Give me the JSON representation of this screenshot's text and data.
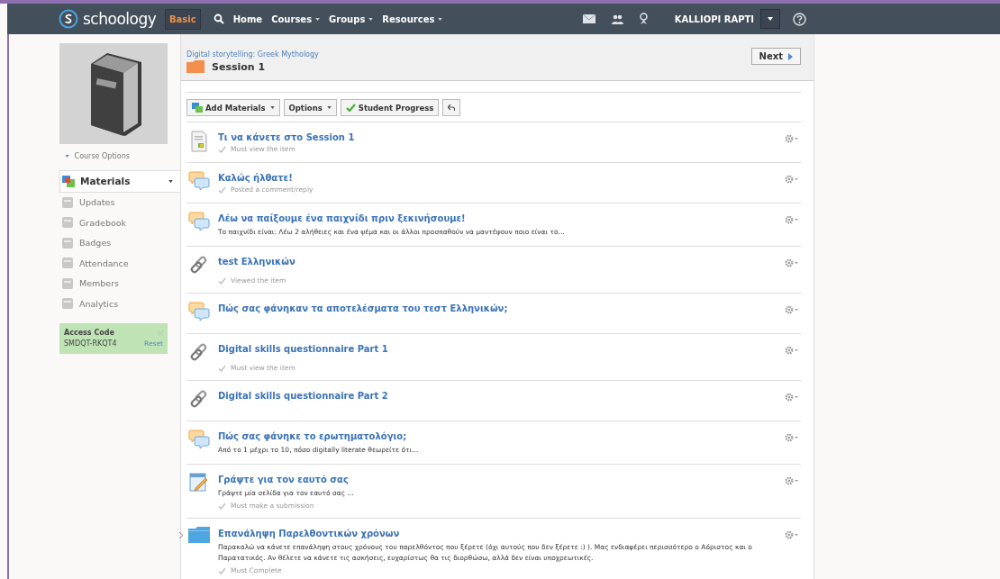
{
  "topbar": {
    "logo": "schoology",
    "mode": "Basic",
    "nav": [
      {
        "label": "Home",
        "menu": false
      },
      {
        "label": "Courses",
        "menu": true
      },
      {
        "label": "Groups",
        "menu": true
      },
      {
        "label": "Resources",
        "menu": true
      }
    ],
    "user": "KALLIOPI RAPTI"
  },
  "sidebar": {
    "course_options": "Course Options",
    "items": [
      {
        "label": "Materials",
        "selected": true
      },
      {
        "label": "Updates",
        "selected": false
      },
      {
        "label": "Gradebook",
        "selected": false
      },
      {
        "label": "Badges",
        "selected": false
      },
      {
        "label": "Attendance",
        "selected": false
      },
      {
        "label": "Members",
        "selected": false
      },
      {
        "label": "Analytics",
        "selected": false
      }
    ],
    "access_code": {
      "title": "Access Code",
      "code": "SMDQT-RKQT4",
      "reset": "Reset"
    }
  },
  "header": {
    "breadcrumb": "Digital storytelling: Greek Mythology",
    "title": "Session 1",
    "next": "Next"
  },
  "toolbar": {
    "add": "Add Materials",
    "options": "Options",
    "progress": "Student Progress"
  },
  "items": [
    {
      "kind": "page",
      "title": "Τι να κάνετε στο Session 1",
      "requirement": "Must view the item"
    },
    {
      "kind": "discussion",
      "title": "Καλώς ήλθατε!",
      "requirement": "Posted a comment/reply"
    },
    {
      "kind": "discussion",
      "title": "Λέω να παίξουμε ένα παιχνίδι πριν ξεκινήσουμε!",
      "description": "Το παιχνίδι είναι: Λέω 2 αλήθειες και ένα ψέμα και οι άλλοι προσπαθούν να μαντέψουν ποιο είναι το..."
    },
    {
      "kind": "link",
      "title": "test Ελληνικών",
      "requirement": "Viewed the item"
    },
    {
      "kind": "discussion",
      "title": "Πώς σας φάνηκαν τα αποτελέσματα του τεστ Ελληνικών;"
    },
    {
      "kind": "link",
      "title": "Digital skills questionnaire Part 1",
      "requirement": "Must view the item"
    },
    {
      "kind": "link",
      "title": "Digital skills questionnaire Part 2"
    },
    {
      "kind": "discussion",
      "title": "Πώς σας φάνηκε το ερωτηματολόγιο;",
      "description": "Από το 1 μέχρι το 10, πόσο digitally literate θεωρείτε ότι..."
    },
    {
      "kind": "assignment",
      "title": "Γράψτε για τον εαυτό σας",
      "description": "Γράψτε μία σελίδα για τον εαυτό σας ...",
      "requirement": "Must make a submission"
    },
    {
      "kind": "folder",
      "title": "Επανάληψη Παρελθοντικών χρόνων",
      "description": "Παρακαλώ να κάνετε επανάληψη στους χρόνους του παρελθόντος που ξέρετε (όχι αυτούς που δεν ξέρετε :) ). Μας ενδιαφέρει περισσότερο ο Αόριστος και ο Παρατατικός. Αν θέλετε να κάνετε τις ασκήσεις, ευχαρίστως θα τις διορθώσω, αλλά δεν είναι υποχρεωτικές.",
      "requirement": "Must Complete"
    }
  ]
}
